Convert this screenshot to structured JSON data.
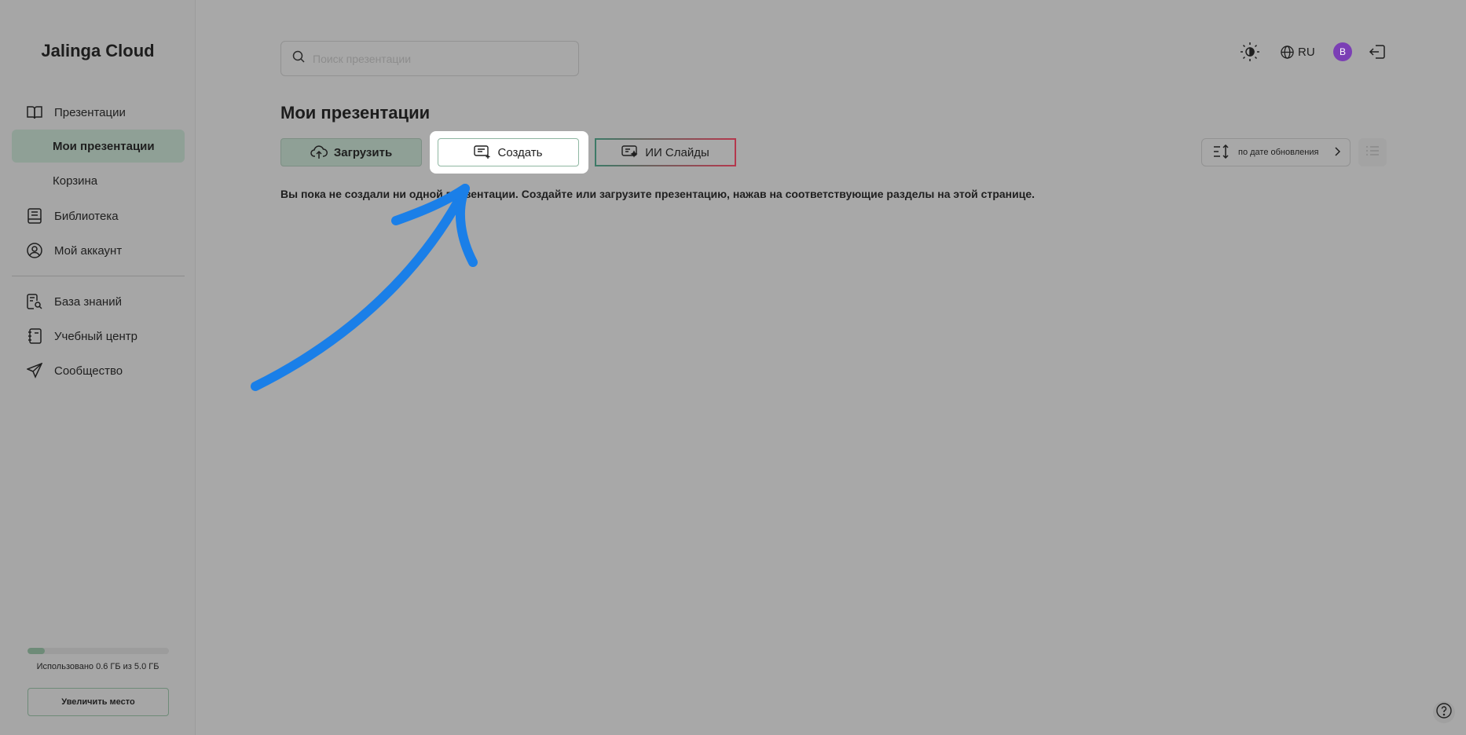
{
  "sidebar": {
    "brand": "Jalinga Cloud",
    "items": [
      {
        "label": "Презентации",
        "icon": "book-open-icon"
      },
      {
        "label": "Мои презентации",
        "icon": ""
      },
      {
        "label": "Корзина",
        "icon": ""
      },
      {
        "label": "Библиотека",
        "icon": "library-book-icon"
      },
      {
        "label": "Мой аккаунт",
        "icon": "user-circle-icon"
      },
      {
        "label": "База знаний",
        "icon": "knowledge-search-icon"
      },
      {
        "label": "Учебный центр",
        "icon": "notebook-icon"
      },
      {
        "label": "Сообщество",
        "icon": "send-icon"
      }
    ],
    "active_item": "Мои презентации",
    "storage": {
      "used_fraction": 0.12,
      "text": "Использовано 0.6 ГБ из 5.0 ГБ"
    },
    "increase_button": "Увеличить место"
  },
  "header": {
    "search_placeholder": "Поиск презентации",
    "language": "RU",
    "avatar_letter": "B",
    "icons": [
      "theme-toggle-icon",
      "globe-icon",
      "logout-icon"
    ]
  },
  "main": {
    "title": "Мои презентации",
    "buttons": {
      "upload": "Загрузить",
      "create": "Создать",
      "ai_slides": "ИИ Слайды"
    },
    "sort_label": "по дате обновления",
    "empty_message": "Вы пока не создали ни одной презентации. Создайте или загрузите презентацию, нажав на соответствующие разделы на этой странице."
  },
  "colors": {
    "accent": "#6e8b78",
    "active_bg": "#8fa096",
    "annotation_arrow": "#1a7fe8",
    "avatar": "#7b3fb5"
  }
}
